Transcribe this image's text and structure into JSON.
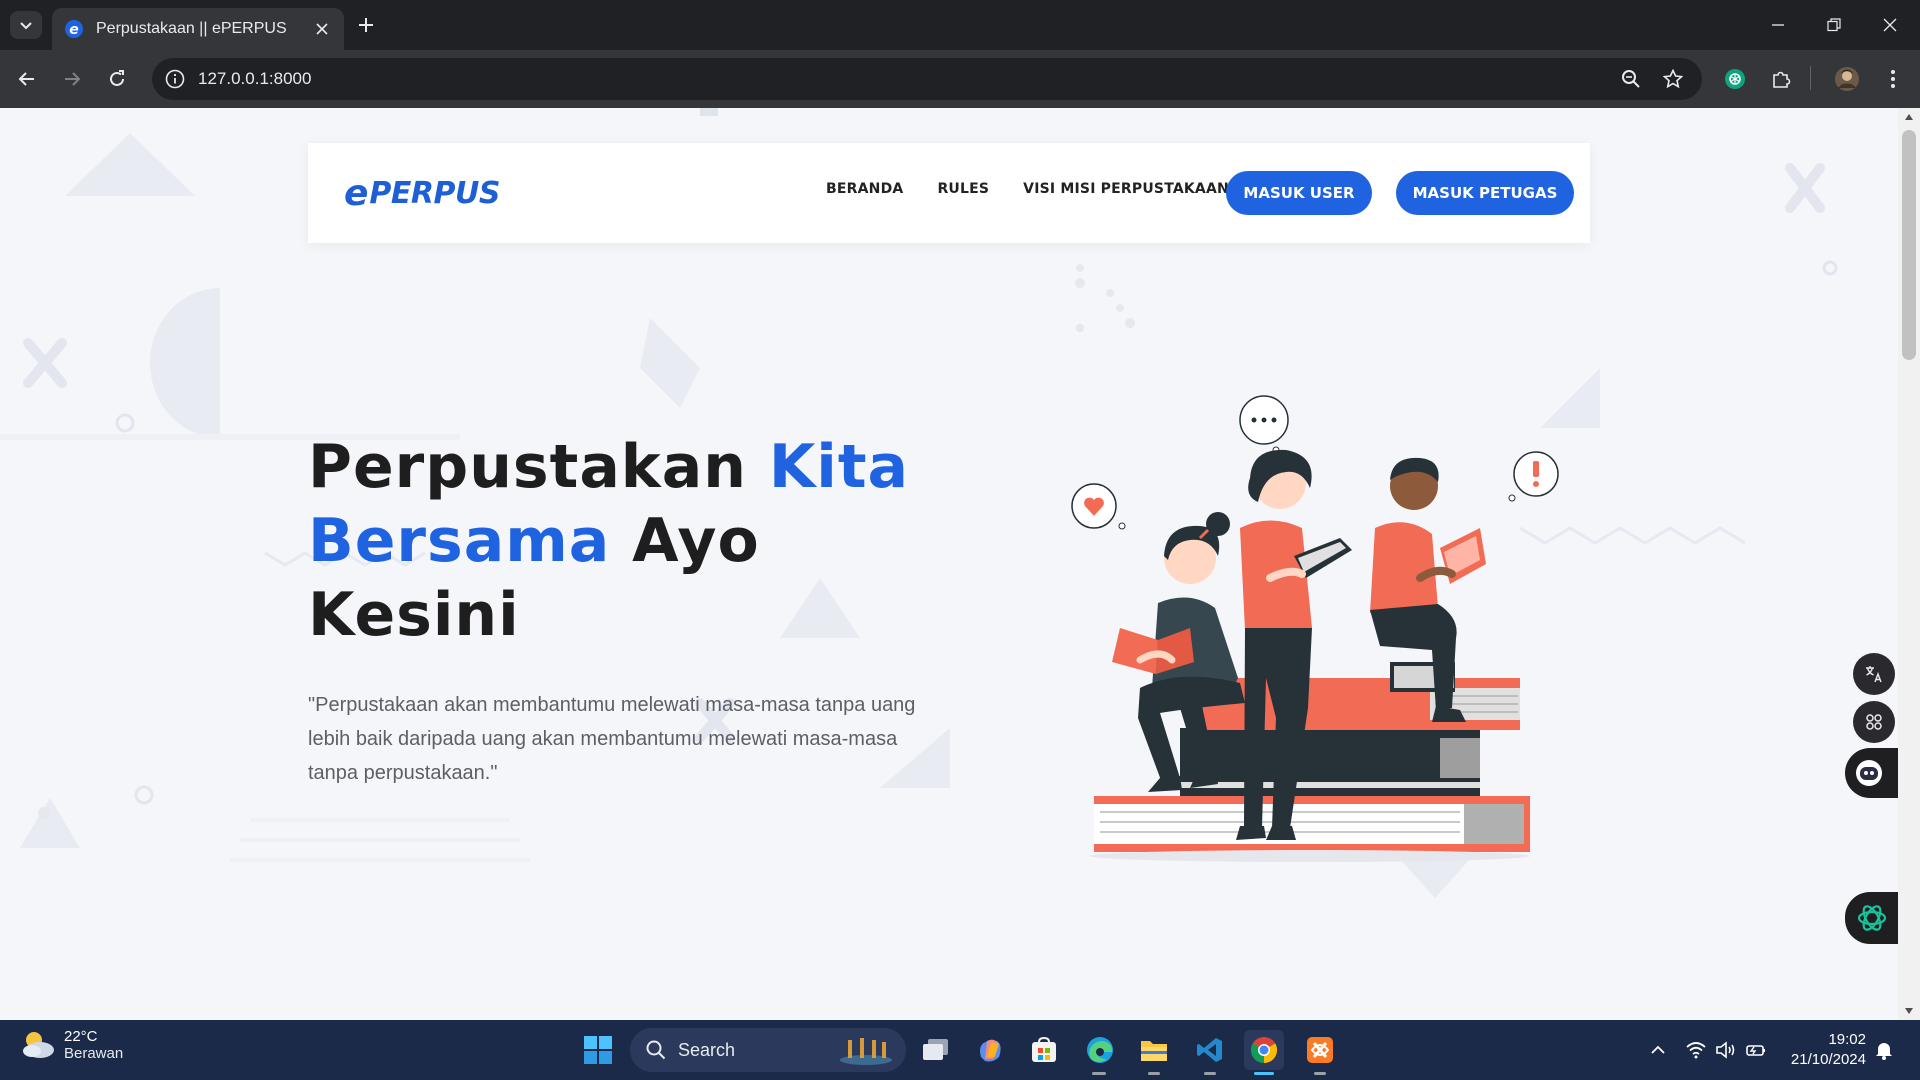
{
  "browser": {
    "tab_title": "Perpustakaan || ePERPUS",
    "url": "127.0.0.1:8000"
  },
  "site": {
    "brand_prefix": "e",
    "brand_name": "PERPUS",
    "nav": [
      {
        "label": "BERANDA"
      },
      {
        "label": "RULES"
      },
      {
        "label": "VISI MISI PERPUSTAKAAN"
      }
    ],
    "buttons": {
      "user_login": "MASUK USER",
      "staff_login": "MASUK PETUGAS"
    },
    "hero": {
      "title_part1": "Perpustakan ",
      "title_accent1": "Kita",
      "title_accent2": "Bersama",
      "title_part2": " Ayo",
      "title_part3": "Kesini",
      "quote": "\"Perpustakaan akan membantumu melewati masa-masa tanpa uang lebih baik daripada uang akan membantumu melewati masa-masa tanpa perpustakaan.\""
    },
    "colors": {
      "accent": "#1f63e0",
      "illustration_red": "#f26b55",
      "illustration_dark": "#263238"
    }
  },
  "taskbar": {
    "weather_temp": "22°C",
    "weather_desc": "Berawan",
    "search_label": "Search",
    "time": "19:02",
    "date": "21/10/2024"
  }
}
